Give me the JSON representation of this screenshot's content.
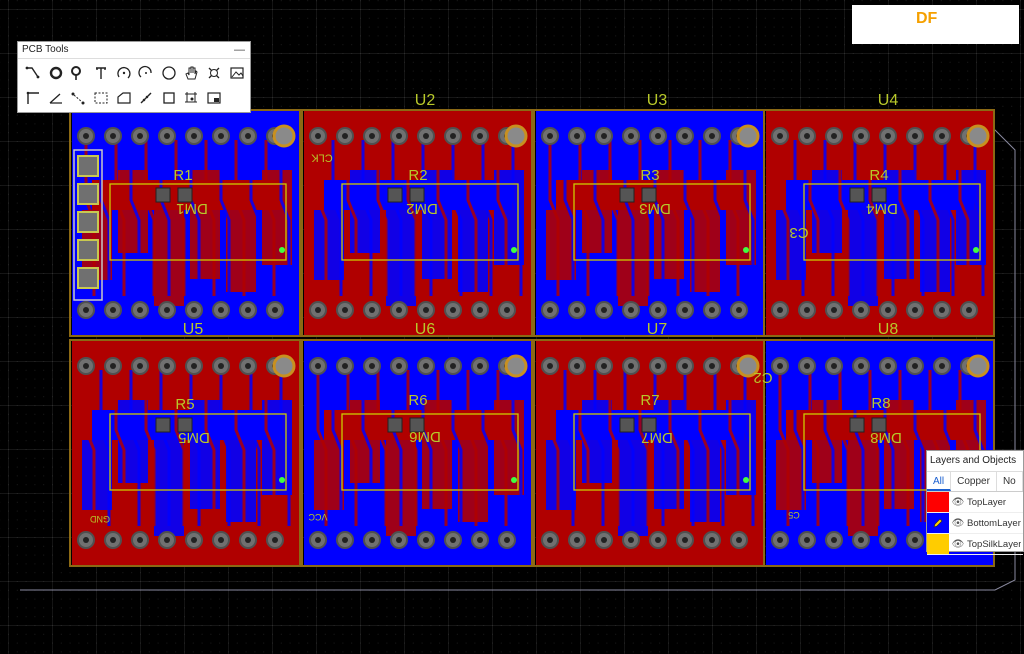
{
  "logo": {
    "text": "DF"
  },
  "pcb_tools": {
    "title": "PCB Tools",
    "minimize": "—",
    "row1": [
      "route-track-icon",
      "via-icon",
      "pad-icon",
      "text-icon",
      "arc-icon",
      "arc-center-icon",
      "circle-icon",
      "move-hand-icon",
      "pan-icon",
      "image-icon"
    ],
    "row2": [
      "corner-icon",
      "angle-icon",
      "dimension-icon",
      "rect-dashed-icon",
      "polygon-icon",
      "measure-icon",
      "rect-icon",
      "canvas-origin-icon",
      "footprint-icon"
    ]
  },
  "board": {
    "components": {
      "u": [
        "U2",
        "U3",
        "U4",
        "U5",
        "U6",
        "U7",
        "U8"
      ],
      "r": [
        "R1",
        "R2",
        "R3",
        "R4",
        "R5",
        "R6",
        "R7",
        "R8"
      ],
      "dm": [
        "DM1",
        "DM2",
        "DM3",
        "DM4",
        "DM5",
        "DM6",
        "DM7",
        "DM8"
      ],
      "nets": [
        "CLK",
        "GND",
        "VCC",
        "C3",
        "C2",
        "C5"
      ]
    },
    "colors": {
      "background": "#000000",
      "top": "#b00000",
      "bottom": "#0000ff",
      "pad": "#8a8a8a",
      "silk": "#cccc00",
      "outline": "#8b6914",
      "text": "#b8c82a"
    }
  },
  "layers_panel": {
    "title": "Layers and Objects",
    "tabs": [
      "All",
      "Copper",
      "No"
    ],
    "layers": [
      {
        "name": "TopLayer",
        "color": "#ff0000"
      },
      {
        "name": "BottomLayer",
        "color": "#0000ff"
      },
      {
        "name": "TopSilkLayer",
        "color": "#ffcc00"
      }
    ]
  }
}
